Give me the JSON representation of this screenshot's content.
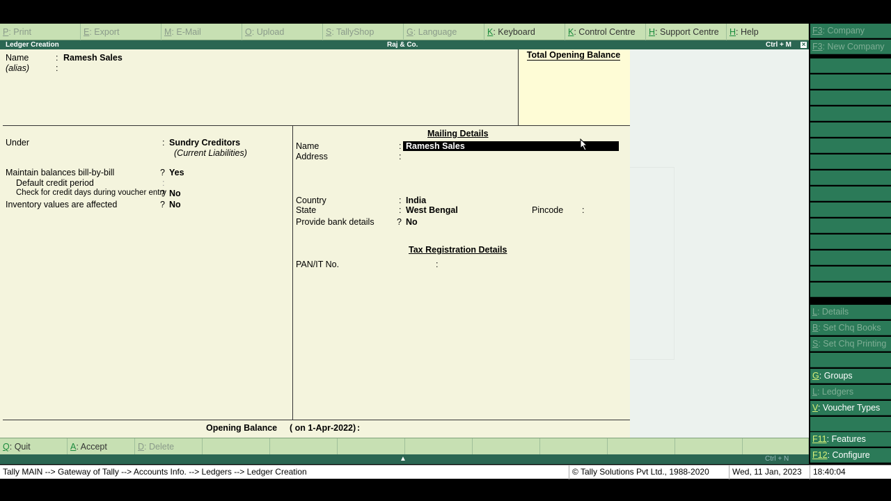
{
  "toolbar": {
    "buttons": [
      {
        "key": "P",
        "label": "Print",
        "disabled": true
      },
      {
        "key": "E",
        "label": "Export",
        "disabled": true
      },
      {
        "key": "M",
        "label": "E-Mail",
        "disabled": true
      },
      {
        "key": "O",
        "label": "Upload",
        "disabled": true
      },
      {
        "key": "S",
        "label": "TallyShop",
        "disabled": true
      },
      {
        "key": "G",
        "label": "Language",
        "disabled": true
      },
      {
        "key": "K",
        "label": "Keyboard",
        "disabled": false
      },
      {
        "key": "K",
        "label": "Control Centre",
        "disabled": false
      },
      {
        "key": "H",
        "label": "Support Centre",
        "disabled": false
      },
      {
        "key": "H",
        "label": "Help",
        "disabled": false
      }
    ]
  },
  "titlebar": {
    "screen_title": "Ledger Creation",
    "company": "Raj & Co.",
    "shortcut": "Ctrl + M",
    "close": "×"
  },
  "header": {
    "name_label": "Name",
    "name_colon": ":",
    "name_value": "Ramesh Sales",
    "alias_label": "(alias)",
    "alias_colon": ":",
    "total_opening_balance": "Total Opening Balance"
  },
  "left_panel": {
    "under_label": "Under",
    "under_colon": ":",
    "under_value": "Sundry Creditors",
    "under_sub": "(Current Liabilities)",
    "bill_label": "Maintain balances bill-by-bill",
    "bill_sep": "?",
    "bill_value": "Yes",
    "credit_period_label": "Default credit period",
    "credit_period_colon": ":",
    "credit_days_label": "Check for credit days during voucher entry",
    "credit_days_sep": "?",
    "credit_days_value": "No",
    "inventory_label": "Inventory values are affected",
    "inventory_sep": "?",
    "inventory_value": "No"
  },
  "mailing": {
    "title": "Mailing Details",
    "name_label": "Name",
    "name_colon": ":",
    "name_value": "Ramesh Sales",
    "address_label": "Address",
    "address_colon": ":",
    "country_label": "Country",
    "country_colon": ":",
    "country_value": "India",
    "state_label": "State",
    "state_colon": ":",
    "state_value": "West Bengal",
    "pincode_label": "Pincode",
    "pincode_colon": ":",
    "bank_label": "Provide bank details",
    "bank_sep": "?",
    "bank_value": "No"
  },
  "tax": {
    "title": "Tax Registration Details",
    "pan_label": "PAN/IT No.",
    "pan_colon": ":"
  },
  "opening_balance": {
    "label": "Opening Balance",
    "date": "( on 1-Apr-2022)",
    "colon": ":"
  },
  "bottom_toolbar": {
    "buttons": [
      {
        "key": "Q",
        "label": "Quit",
        "disabled": false
      },
      {
        "key": "A",
        "label": "Accept",
        "disabled": false
      },
      {
        "key": "D",
        "label": "Delete",
        "disabled": true
      }
    ],
    "arrow": "▲",
    "shortcut": "Ctrl + N"
  },
  "statusbar": {
    "breadcrumb": "Tally MAIN --> Gateway of Tally --> Accounts Info. --> Ledgers --> Ledger Creation",
    "copyright": "© Tally Solutions Pvt Ltd., 1988-2020",
    "date": "Wed, 11 Jan, 2023",
    "time": "18:40:04"
  },
  "sidebar": {
    "company_key": "F3",
    "company_label": "Company",
    "new_company_key": "F3",
    "new_company_label": "New Company",
    "details_key": "L",
    "details_label": "Details",
    "chq_books_key": "B",
    "chq_books_label": "Set Chq Books",
    "chq_printing_key": "S",
    "chq_printing_label": "Set Chq Printing",
    "groups_key": "G",
    "groups_label": "Groups",
    "ledgers_key": "L",
    "ledgers_label": "Ledgers",
    "voucher_types_key": "V",
    "voucher_types_label": "Voucher Types",
    "features_key": "F11",
    "features_label": "Features",
    "configure_key": "F12",
    "configure_label": "Configure"
  },
  "colors": {
    "toolbar_bg": "#c7e0b3",
    "titlebar_bg": "#2b6652",
    "panel_bg": "#f4f4dd",
    "sidebar_bg": "#2b7a58",
    "key_accent": "#1a8a3c"
  }
}
